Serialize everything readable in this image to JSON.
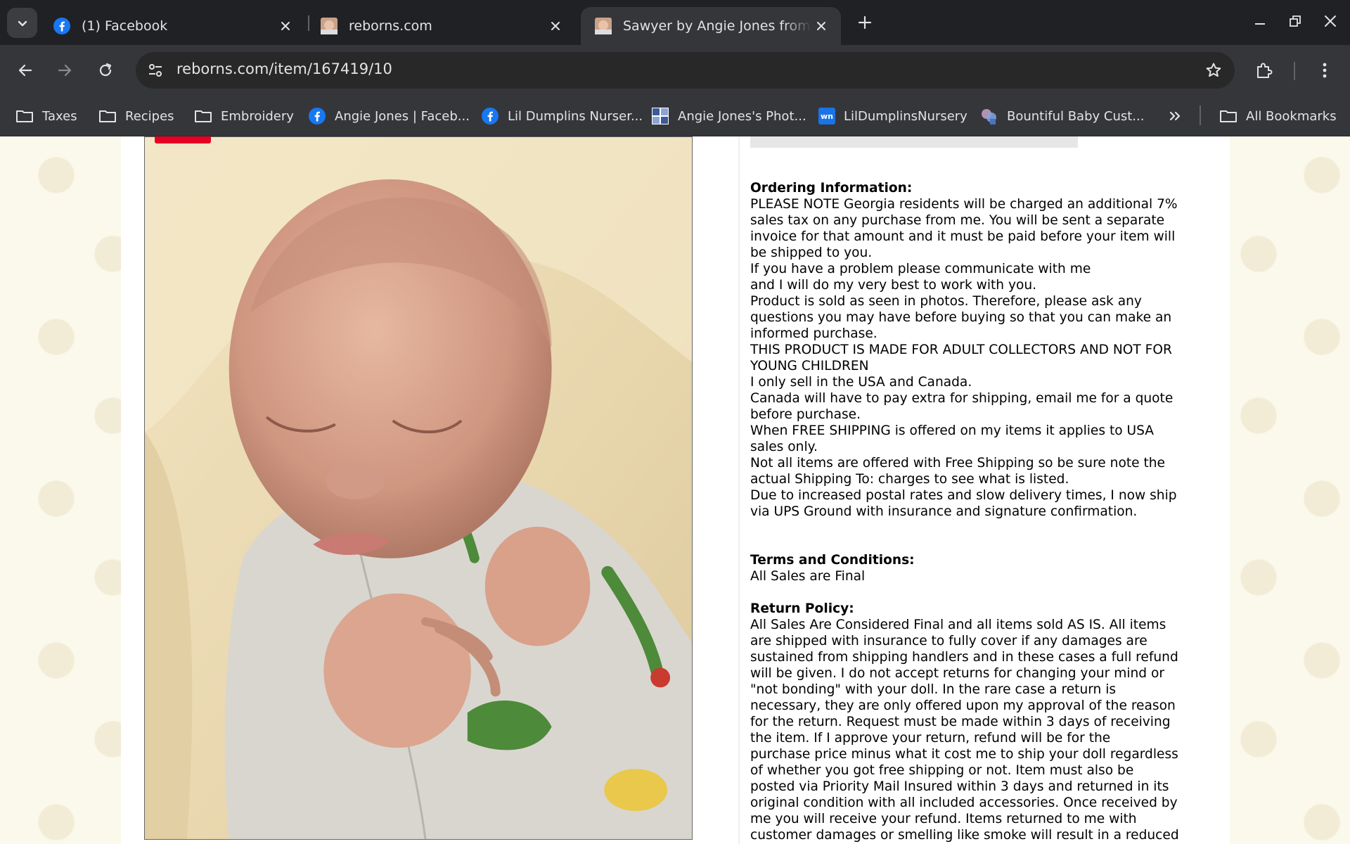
{
  "browser": {
    "tabs": [
      {
        "title": "(1) Facebook",
        "favicon": "facebook-icon",
        "active": false
      },
      {
        "title": "reborns.com",
        "favicon": "doll-photo-icon",
        "active": false
      },
      {
        "title": "Sawyer by Angie Jones from Lil Dumplins Nursery",
        "favicon": "doll-photo-icon",
        "active": true
      }
    ],
    "url": "reborns.com/item/167419/10",
    "bookmarks": [
      {
        "label": "Taxes",
        "icon": "folder-icon"
      },
      {
        "label": "Recipes",
        "icon": "folder-icon"
      },
      {
        "label": "Embroidery",
        "icon": "folder-icon"
      },
      {
        "label": "Angie Jones | Faceb...",
        "icon": "facebook-icon"
      },
      {
        "label": "Lil Dumplins Nurser...",
        "icon": "facebook-icon"
      },
      {
        "label": "Angie Jones's Phot...",
        "icon": "photo-grid-icon"
      },
      {
        "label": "LilDumplinsNursery",
        "icon": "wn-icon"
      },
      {
        "label": "Bountiful Baby Cust...",
        "icon": "bountiful-baby-icon"
      }
    ],
    "all_bookmarks": "All Bookmarks",
    "wn_text": "wn",
    "colors": {
      "chrome_dark": "#202124",
      "toolbar": "#35363a",
      "facebook_blue": "#1877f2",
      "pin_red": "#e60023",
      "page_bg": "#fbf9ec"
    }
  },
  "listing": {
    "ordering": {
      "heading": "Ordering Information:",
      "lines": [
        "PLEASE NOTE Georgia residents will be charged an additional 7%",
        "sales tax on any purchase from me. You will be sent a separate",
        "invoice for that amount and it must be paid before your item will",
        "be shipped to you.",
        "If you have a problem please communicate with me",
        "and I will do my very best to work with you.",
        "Product is sold as seen in photos. Therefore, please ask any",
        "questions you may have before buying so that you can make an",
        "informed purchase.",
        "THIS PRODUCT IS MADE FOR ADULT COLLECTORS AND NOT FOR",
        "YOUNG CHILDREN",
        "I only sell in the USA and Canada.",
        "Canada will have to pay extra for shipping, email me for a quote",
        "before purchase.",
        "When FREE SHIPPING is offered on my items it applies to USA",
        "sales only.",
        "Not all items are offered with Free Shipping so be sure note the",
        "actual Shipping To: charges to see what is listed.",
        "Due to increased postal rates and slow delivery times, I now ship",
        "via UPS Ground with insurance and signature confirmation."
      ]
    },
    "terms": {
      "heading": "Terms and Conditions:",
      "lines": [
        "All Sales are Final"
      ]
    },
    "returns": {
      "heading": "Return Policy:",
      "lines": [
        "All Sales Are Considered Final and all items sold AS IS. All items",
        "are shipped with insurance to fully cover if any damages are",
        "sustained from shipping handlers and in these cases a full refund",
        "will be given. I do not accept returns for changing your mind or",
        "\"not bonding\" with your doll. In the rare case a return is",
        "necessary, they are only offered upon my approval of the reason",
        "for the return. Request must be made within 3 days of receiving",
        "the item. If I approve your return, refund will be for the",
        "purchase price minus what it cost me to ship your doll regardless",
        "of whether you got free shipping or not. Item must also be",
        "posted via Priority Mail Insured within 3 days and returned in its",
        "original condition with all included accessories. Once received by",
        "me you will receive your refund. Items returned to me with",
        "customer damages or smelling like smoke will result in a reduced"
      ]
    },
    "photo_icon": "reborn-baby-doll-photo"
  }
}
